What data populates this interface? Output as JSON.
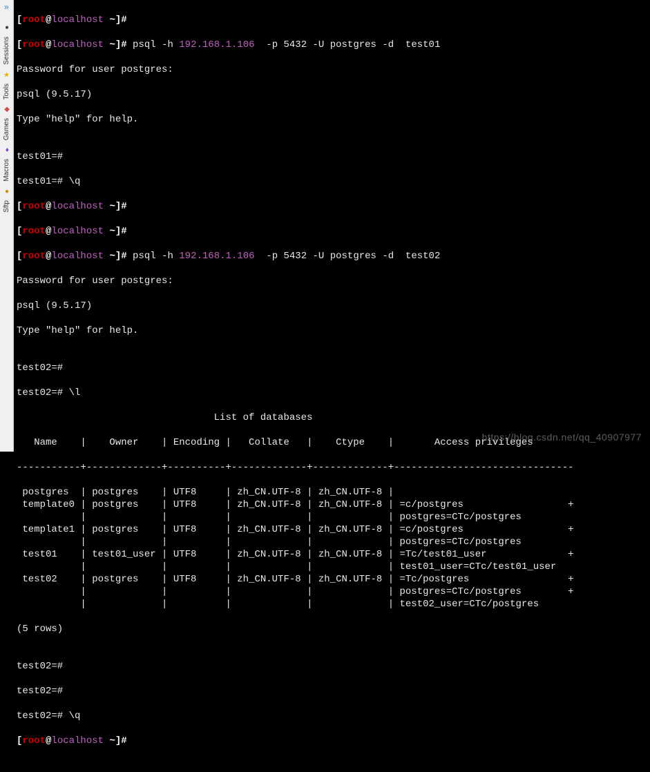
{
  "sidebar": {
    "tabs": [
      {
        "label": "Sessions",
        "icon": "●",
        "iconClass": "ico-sessions"
      },
      {
        "label": "Tools",
        "icon": "★",
        "iconClass": "ico-tools"
      },
      {
        "label": "Games",
        "icon": "◆",
        "iconClass": "ico-games"
      },
      {
        "label": "Macros",
        "icon": "♦",
        "iconClass": "ico-macros"
      },
      {
        "label": "Sftp",
        "icon": "●",
        "iconClass": "ico-sftp"
      }
    ]
  },
  "prompt": {
    "lbracket": "[",
    "user": "root",
    "at": "@",
    "host": "localhost",
    "tail": " ~]#"
  },
  "connection": {
    "ip": "192.168.1.106",
    "port": "5432",
    "db_user": "postgres",
    "db1": "test01",
    "db2": "test02"
  },
  "lines": {
    "psql_cmd1_pre": " psql -h ",
    "psql_cmd1_mid": "  -p 5432 -U postgres -d  test01",
    "pwprompt": "Password for user postgres:",
    "psqlver": "psql (9.5.17)",
    "helpline": "Type \"help\" for help.",
    "blank": "",
    "p_test01": "test01=#",
    "p_test01_q": "test01=# \\q",
    "psql_cmd2_pre": " psql -h ",
    "psql_cmd2_mid": "  -p 5432 -U postgres -d  test02",
    "p_test02": "test02=#",
    "p_test02_l": "test02=# \\l",
    "p_test02_q": "test02=# \\q"
  },
  "db_list": {
    "title": "                                  List of databases",
    "header": "   Name    |    Owner    | Encoding |   Collate   |    Ctype    |       Access privileges       ",
    "sep": "-----------+-------------+----------+-------------+-------------+-------------------------------",
    "rows": [
      " postgres  | postgres    | UTF8     | zh_CN.UTF-8 | zh_CN.UTF-8 | ",
      " template0 | postgres    | UTF8     | zh_CN.UTF-8 | zh_CN.UTF-8 | =c/postgres                  +",
      "           |             |          |             |             | postgres=CTc/postgres",
      " template1 | postgres    | UTF8     | zh_CN.UTF-8 | zh_CN.UTF-8 | =c/postgres                  +",
      "           |             |          |             |             | postgres=CTc/postgres",
      " test01    | test01_user | UTF8     | zh_CN.UTF-8 | zh_CN.UTF-8 | =Tc/test01_user              +",
      "           |             |          |             |             | test01_user=CTc/test01_user",
      " test02    | postgres    | UTF8     | zh_CN.UTF-8 | zh_CN.UTF-8 | =Tc/postgres                 +",
      "           |             |          |             |             | postgres=CTc/postgres        +",
      "           |             |          |             |             | test02_user=CTc/postgres"
    ],
    "footer": "(5 rows)"
  },
  "chart_data": {
    "type": "table",
    "title": "List of databases",
    "columns": [
      "Name",
      "Owner",
      "Encoding",
      "Collate",
      "Ctype",
      "Access privileges"
    ],
    "data": [
      {
        "Name": "postgres",
        "Owner": "postgres",
        "Encoding": "UTF8",
        "Collate": "zh_CN.UTF-8",
        "Ctype": "zh_CN.UTF-8",
        "Access privileges": ""
      },
      {
        "Name": "template0",
        "Owner": "postgres",
        "Encoding": "UTF8",
        "Collate": "zh_CN.UTF-8",
        "Ctype": "zh_CN.UTF-8",
        "Access privileges": "=c/postgres\npostgres=CTc/postgres"
      },
      {
        "Name": "template1",
        "Owner": "postgres",
        "Encoding": "UTF8",
        "Collate": "zh_CN.UTF-8",
        "Ctype": "zh_CN.UTF-8",
        "Access privileges": "=c/postgres\npostgres=CTc/postgres"
      },
      {
        "Name": "test01",
        "Owner": "test01_user",
        "Encoding": "UTF8",
        "Collate": "zh_CN.UTF-8",
        "Ctype": "zh_CN.UTF-8",
        "Access privileges": "=Tc/test01_user\ntest01_user=CTc/test01_user"
      },
      {
        "Name": "test02",
        "Owner": "postgres",
        "Encoding": "UTF8",
        "Collate": "zh_CN.UTF-8",
        "Ctype": "zh_CN.UTF-8",
        "Access privileges": "=Tc/postgres\npostgres=CTc/postgres\ntest02_user=CTc/postgres"
      }
    ],
    "row_count": 5
  },
  "watermark": "https://blog.csdn.net/qq_40907977"
}
